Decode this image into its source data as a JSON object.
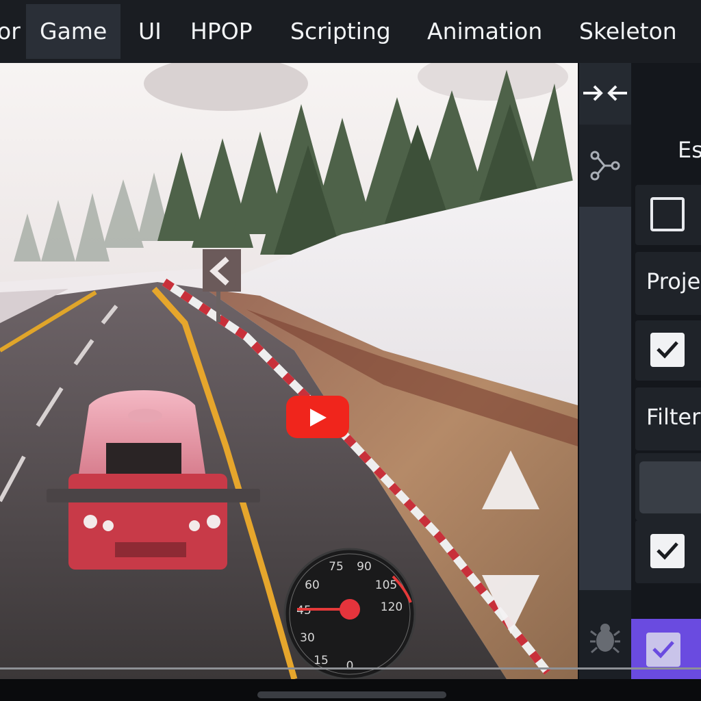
{
  "menu": {
    "items": [
      {
        "label": "or",
        "active": false
      },
      {
        "label": "Game",
        "active": true
      },
      {
        "label": "UI",
        "active": false
      },
      {
        "label": "HPOP",
        "active": false
      },
      {
        "label": "Scripting",
        "active": false
      },
      {
        "label": "Animation",
        "active": false
      },
      {
        "label": "Skeleton",
        "active": false
      }
    ]
  },
  "toolbar": {
    "icons": [
      "collapse-arrows-icon",
      "node-graph-icon",
      "bug-icon"
    ]
  },
  "panel": {
    "row1_label": "Es",
    "row2_checked": false,
    "row3_label": "Proje",
    "row4_checked": true,
    "row5_label": "Filter",
    "row7_checked": true,
    "row8_checked": true
  },
  "game": {
    "speedometer": {
      "ticks": [
        "15",
        "30",
        "45",
        "60",
        "75",
        "90",
        "105",
        "120",
        "0"
      ],
      "needle_value": "45"
    },
    "controls": [
      "accelerate-up-icon",
      "brake-down-icon"
    ],
    "video_overlay": "youtube-play-icon"
  },
  "colors": {
    "menubar": "#1a1d22",
    "panel": "#14171c",
    "accent_purple": "#6a4be0",
    "youtube_red": "#f0251c"
  }
}
